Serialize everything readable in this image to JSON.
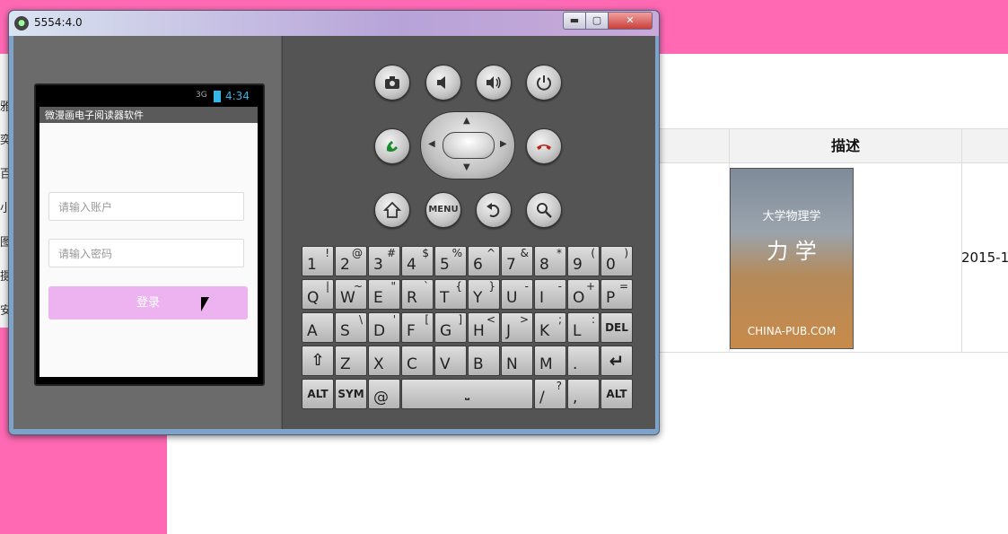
{
  "background_page": {
    "sidebar_chars": [
      "雅",
      "奕",
      "百",
      "小",
      "图",
      "摄",
      "安"
    ],
    "table": {
      "header_description": "描述",
      "row_date": "2015-1"
    },
    "book_cover": {
      "title_line1": "大学物理学",
      "title_line2": "力 学",
      "publisher": "CHINA-PUB.COM"
    }
  },
  "emulator": {
    "window_title": "5554:4.0",
    "title_icon": "android-emulator-icon",
    "controls": {
      "minimize": "▬",
      "maximize": "▢",
      "close": "✕"
    },
    "phone": {
      "status_signal": "3G",
      "status_time": "4:34",
      "app_title": "微漫画电子阅读器软件",
      "account_placeholder": "请输入账户",
      "password_placeholder": "请输入密码",
      "login_label": "登录",
      "accent_color": "#33b5e5",
      "login_color": "#edb2f0"
    },
    "hardware_buttons": {
      "menu_label": "MENU"
    },
    "keyboard": {
      "rows": [
        [
          [
            "1",
            "!"
          ],
          [
            "2",
            "@"
          ],
          [
            "3",
            "#"
          ],
          [
            "4",
            "$"
          ],
          [
            "5",
            "%"
          ],
          [
            "6",
            "^"
          ],
          [
            "7",
            "&"
          ],
          [
            "8",
            "*"
          ],
          [
            "9",
            "("
          ],
          [
            "0",
            ")"
          ]
        ],
        [
          [
            "Q",
            "|"
          ],
          [
            "W",
            "~"
          ],
          [
            "E",
            "\""
          ],
          [
            "R",
            "`"
          ],
          [
            "T",
            "{"
          ],
          [
            "Y",
            "}"
          ],
          [
            "U",
            "-"
          ],
          [
            "I",
            "-"
          ],
          [
            "O",
            "+"
          ],
          [
            "P",
            "="
          ]
        ],
        [
          [
            "A",
            ""
          ],
          [
            "S",
            "\\"
          ],
          [
            "D",
            "'"
          ],
          [
            "F",
            "["
          ],
          [
            "G",
            "]"
          ],
          [
            "H",
            "<"
          ],
          [
            "J",
            ">"
          ],
          [
            "K",
            ";"
          ],
          [
            "L",
            ":"
          ]
        ],
        [
          [
            "Z",
            ""
          ],
          [
            "X",
            ""
          ],
          [
            "C",
            ""
          ],
          [
            "V",
            ""
          ],
          [
            "B",
            ""
          ],
          [
            "N",
            ""
          ],
          [
            "M",
            ""
          ],
          [
            ".",
            ""
          ]
        ]
      ],
      "del_label": "DEL",
      "alt_label": "ALT",
      "sym_label": "SYM",
      "at_label": "@",
      "slash_key": [
        "/",
        "?"
      ],
      "comma_key": [
        ",",
        ""
      ]
    }
  }
}
